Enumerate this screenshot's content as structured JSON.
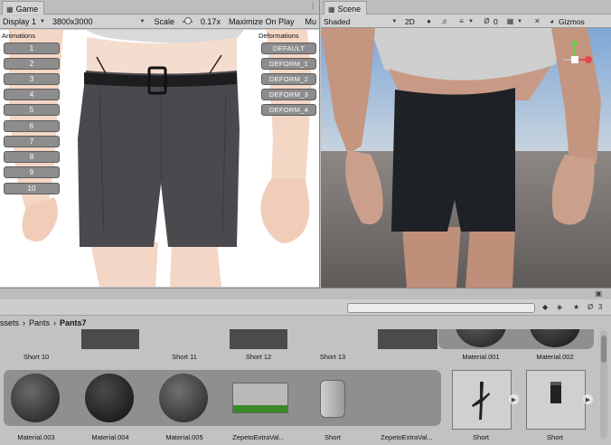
{
  "game": {
    "tab_label": "Game",
    "display": "Display 1",
    "resolution": "3800x3000",
    "scale_label": "Scale",
    "scale_value": "0.17x",
    "maximize": "Maximize On Play",
    "mute": "Mu",
    "animations_label": "Animations",
    "deformations_label": "Deformations",
    "animation_buttons": [
      "1",
      "2",
      "3",
      "4",
      "5",
      "6",
      "7",
      "8",
      "9",
      "10"
    ],
    "deformation_buttons": [
      "DEFAULT",
      "DEFORM_1",
      "DEFORM_2",
      "DEFORM_3",
      "DEFORM_4"
    ]
  },
  "scene": {
    "tab_label": "Scene",
    "shading_mode": "Shaded",
    "mode_2d": "2D",
    "hidden_count": "0",
    "gizmos": "Gizmos"
  },
  "project": {
    "breadcrumb": [
      "ssets",
      "Pants",
      "Pants7"
    ],
    "hidden_count": "3",
    "row1": [
      "Short 10",
      "Short 11",
      "Short 12",
      "Short 13",
      "Material.001",
      "Material.002"
    ],
    "row2": [
      "Material.003",
      "Material.004",
      "Material.005",
      "ZepetoExtraVal...",
      "Short",
      "ZepetoExtraVal...",
      "Short",
      "Short"
    ]
  },
  "colors": {
    "pants": "#4a4a4e",
    "skin": "#f3d6c6",
    "button": "#8d8d8d",
    "sky": "#8fb3d8",
    "ground": "#6e6a67"
  }
}
